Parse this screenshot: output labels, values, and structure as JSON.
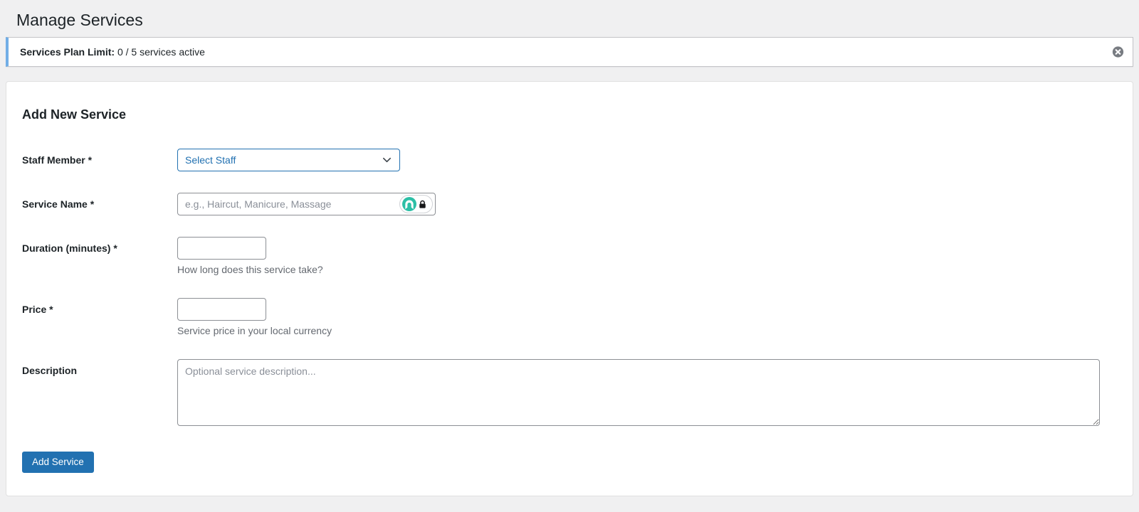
{
  "page": {
    "title": "Manage Services"
  },
  "notice": {
    "label": "Services Plan Limit:",
    "text": " 0 / 5 services active",
    "dismiss_icon": "circle-x-icon",
    "accent_color": "#72aee6"
  },
  "form": {
    "heading": "Add New Service",
    "staff": {
      "label": "Staff Member *",
      "selected_value": "Select Staff"
    },
    "service_name": {
      "label": "Service Name *",
      "placeholder": "e.g., Haircut, Manicure, Massage",
      "badge_icons": [
        "password-manager-icon",
        "padlock-icon"
      ]
    },
    "duration": {
      "label": "Duration (minutes) *",
      "value": "",
      "help": "How long does this service take?"
    },
    "price": {
      "label": "Price *",
      "value": "",
      "help": "Service price in your local currency"
    },
    "description": {
      "label": "Description",
      "placeholder": "Optional service description..."
    },
    "submit_label": "Add Service"
  },
  "colors": {
    "accent": "#2271b1",
    "notice-accent": "#72aee6",
    "badge-teal": "#2cbfa6",
    "page-bg": "#f0f0f1"
  }
}
